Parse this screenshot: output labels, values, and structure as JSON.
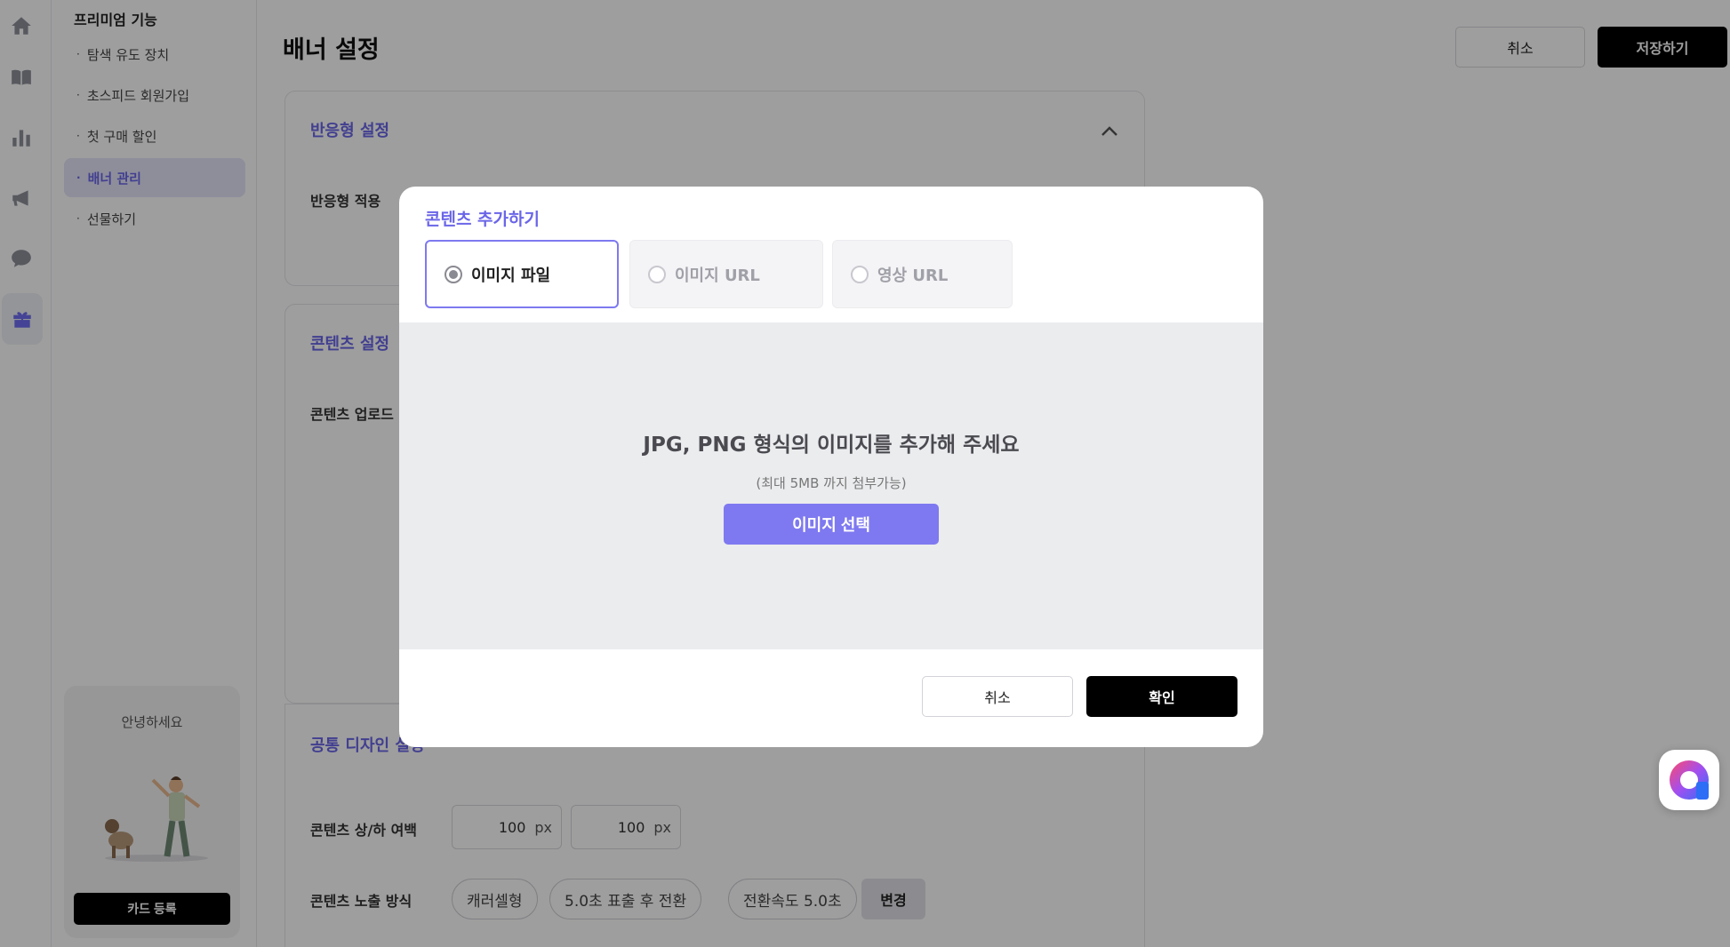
{
  "sidebar": {
    "section_title": "프리미엄 기능",
    "items": [
      {
        "label": "탐색 유도 장치"
      },
      {
        "label": "초스피드 회원가입"
      },
      {
        "label": "첫 구매 할인"
      },
      {
        "label": "배너 관리"
      },
      {
        "label": "선물하기"
      }
    ],
    "bullet": "·",
    "greeting": "안녕하세요",
    "card_button": "카드 등록"
  },
  "header": {
    "title": "배너 설정",
    "cancel_label": "취소",
    "save_label": "저장하기"
  },
  "sections": {
    "responsive": {
      "title": "반응형 설정",
      "row_label": "반응형 적용"
    },
    "content": {
      "title": "콘텐츠 설정",
      "row_label": "콘텐츠 업로드"
    },
    "design": {
      "title": "공통 디자인 설정",
      "margin_label": "콘텐츠 상/하 여백",
      "margin_top": "100",
      "margin_bottom": "100",
      "unit": "px",
      "display_label": "콘텐츠 노출 방식",
      "chips": [
        "캐러셀형",
        "5.0초 표출 후 전환",
        "전환속도 5.0초"
      ],
      "change_label": "변경"
    }
  },
  "modal": {
    "title": "콘텐츠 추가하기",
    "tabs": [
      {
        "label": "이미지 파일",
        "selected": true
      },
      {
        "label": "이미지 URL",
        "selected": false
      },
      {
        "label": "영상 URL",
        "selected": false
      }
    ],
    "dropzone_text": "JPG, PNG 형식의 이미지를 추가해 주세요",
    "dropzone_subtext": "(최대 5MB 까지 첨부가능)",
    "select_label": "이미지 선택",
    "cancel_label": "취소",
    "confirm_label": "확인"
  },
  "colors": {
    "accent": "#7e79f0",
    "accent_text": "#6b66e8",
    "primary_button": "#000000"
  },
  "icons": [
    "home-icon",
    "book-icon",
    "bar-chart-icon",
    "megaphone-icon",
    "chat-bubble-icon",
    "gift-icon",
    "chevron-up-icon",
    "chat-widget-icon"
  ]
}
